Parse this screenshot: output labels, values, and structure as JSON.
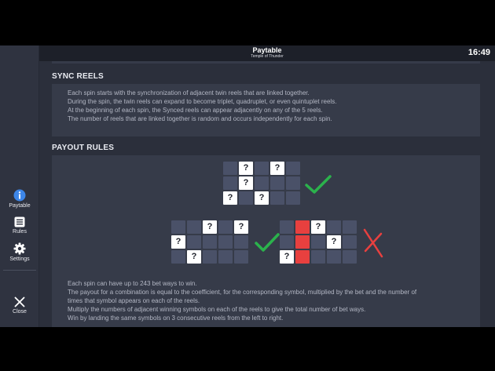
{
  "header": {
    "title": "Paytable",
    "subtitle": "Temple of Thunder",
    "clock": "16:49"
  },
  "sidebar": {
    "paytable_label": "Paytable",
    "rules_label": "Rules",
    "settings_label": "Settings",
    "close_label": "Close"
  },
  "sync_reels": {
    "title": "SYNC REELS",
    "lines": [
      "Each spin starts with the synchronization of adjacent twin reels that are linked together.",
      "During the spin, the twin reels can expand to become triplet, quadruplet, or even quintuplet reels.",
      "At the beginning of each spin, the Synced reels can appear adjacently on any of the 5 reels.",
      "The number of reels that are linked together is random and occurs independently for each spin."
    ]
  },
  "payout_rules": {
    "title": "PAYOUT RULES",
    "symbol": "?",
    "lines": [
      "Each spin can have up to 243 bet ways to win.",
      "The payout for a combination is equal to the coefficient, for the corresponding symbol, multiplied by the bet and the number of",
      "times that symbol appears on each of the reels.",
      "Multiply the numbers of adjacent winning symbols on each of the reels to give the total number of bet ways.",
      "Win by landing the same symbols on 3 consecutive reels from the left to right."
    ]
  },
  "colors": {
    "valid_check": "#2bb24c",
    "invalid_cross": "#e8403f",
    "highlight_reel": "#e8403f"
  }
}
